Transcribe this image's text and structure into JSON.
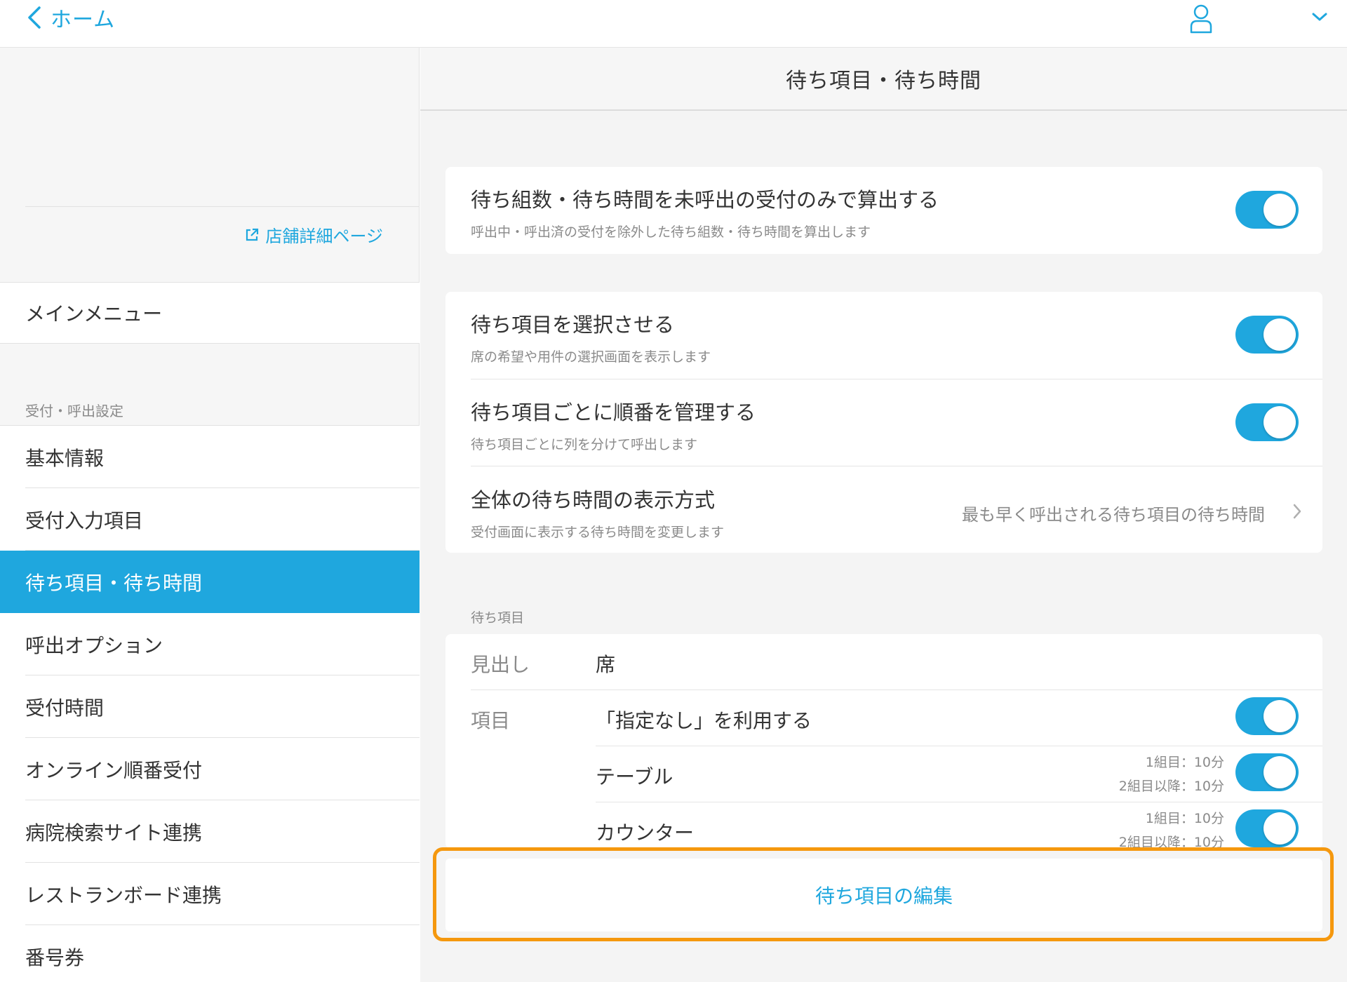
{
  "topbar": {
    "back_label": "ホーム",
    "icons": [
      "chevron-left-icon",
      "user-icon",
      "chevron-down-icon"
    ]
  },
  "sidebar": {
    "store_link": "店舗詳細ページ",
    "main_menu": "メインメニュー",
    "section_label": "受付・呼出設定",
    "items": [
      {
        "label": "基本情報",
        "active": false
      },
      {
        "label": "受付入力項目",
        "active": false
      },
      {
        "label": "待ち項目・待ち時間",
        "active": true
      },
      {
        "label": "呼出オプション",
        "active": false
      },
      {
        "label": "受付時間",
        "active": false
      },
      {
        "label": "オンライン順番受付",
        "active": false
      },
      {
        "label": "病院検索サイト連携",
        "active": false
      },
      {
        "label": "レストランボード連携",
        "active": false
      },
      {
        "label": "番号券",
        "active": false
      }
    ]
  },
  "main": {
    "title": "待ち項目・待ち時間",
    "card1": {
      "title": "待ち組数・待ち時間を未呼出の受付のみで算出する",
      "sub": "呼出中・呼出済の受付を除外した待ち組数・待ち時間を算出します",
      "toggle_on": true
    },
    "card2": [
      {
        "title": "待ち項目を選択させる",
        "sub": "席の希望や用件の選択画面を表示します",
        "toggle_on": true
      },
      {
        "title": "待ち項目ごとに順番を管理する",
        "sub": "待ち項目ごとに列を分けて呼出します",
        "toggle_on": true
      },
      {
        "title": "全体の待ち時間の表示方式",
        "sub": "受付画面に表示する待ち時間を変更します",
        "value": "最も早く呼出される待ち項目の待ち時間"
      }
    ],
    "group_label": "待ち項目",
    "items_card": {
      "heading_label": "見出し",
      "heading_value": "席",
      "items_label": "項目",
      "rows": [
        {
          "name": "「指定なし」を利用する",
          "toggle_on": true
        },
        {
          "name": "テーブル",
          "line1": "1組目：10分",
          "line2": "2組目以降：10分",
          "toggle_on": true
        },
        {
          "name": "カウンター",
          "line1": "1組目：10分",
          "line2": "2組目以降：10分",
          "toggle_on": true
        }
      ]
    },
    "edit_button": "待ち項目の編集",
    "highlight_color": "#f5980e",
    "accent_color": "#1fa7de"
  }
}
